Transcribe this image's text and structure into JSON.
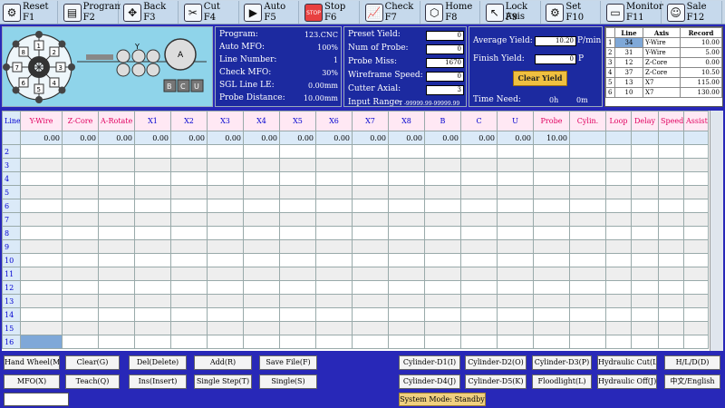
{
  "toolbar": [
    {
      "name": "Reset",
      "key": "F1",
      "icon": "gear-icon"
    },
    {
      "name": "Program",
      "key": "F2",
      "icon": "program-icon"
    },
    {
      "name": "Back",
      "key": "F3",
      "icon": "move-arrows-icon"
    },
    {
      "name": "Cut",
      "key": "F4",
      "icon": "scissors-icon"
    },
    {
      "name": "Auto",
      "key": "F5",
      "icon": "play-icon"
    },
    {
      "name": "Stop",
      "key": "F6",
      "icon": "stop-icon"
    },
    {
      "name": "Check",
      "key": "F7",
      "icon": "check-chart-icon"
    },
    {
      "name": "Home",
      "key": "F8",
      "icon": "home-icon"
    },
    {
      "name": "Lock Axis",
      "key": "F9",
      "icon": "cursor-icon"
    },
    {
      "name": "Set",
      "key": "F10",
      "icon": "settings-icon"
    },
    {
      "name": "Monitor",
      "key": "F11",
      "icon": "monitor-icon"
    },
    {
      "name": "Sale",
      "key": "F12",
      "icon": "user-icon"
    }
  ],
  "machine": {
    "y_label": "Y",
    "a_label": "A",
    "blocks": [
      "B",
      "C",
      "U"
    ],
    "wheel_numbers": [
      "1",
      "2",
      "3",
      "4",
      "5",
      "6",
      "7",
      "8"
    ]
  },
  "info1": {
    "rows": [
      {
        "label": "Program:",
        "value": "123.CNC"
      },
      {
        "label": "Auto MFO:",
        "value": "100%"
      },
      {
        "label": "Line Number:",
        "value": "1"
      },
      {
        "label": "Check MFO:",
        "value": "30%"
      },
      {
        "label": "SGL Line LE:",
        "value": "0.00mm"
      },
      {
        "label": "Probe Distance:",
        "value": "10.00mm"
      }
    ]
  },
  "info2": {
    "rows": [
      {
        "label": "Preset Yield:",
        "value": "0"
      },
      {
        "label": "Num of Probe:",
        "value": "0"
      },
      {
        "label": "Probe Miss:",
        "value": "1670"
      },
      {
        "label": "Wireframe Speed:",
        "value": "0"
      },
      {
        "label": "Cutter Axial:",
        "value": "3"
      }
    ],
    "input_range_label": "Input Range:",
    "input_range_value": "Y -99999.99-99999.99"
  },
  "yield": {
    "average_label": "Average Yield:",
    "average_value": "10.20",
    "average_unit": "P/min",
    "finish_label": "Finish Yield:",
    "finish_value": "0",
    "finish_unit": "P",
    "clear_label": "Clear Yield",
    "time_label": "Time Need:",
    "time_h": "0h",
    "time_m": "0m"
  },
  "records": {
    "headers": [
      "Line",
      "Axis",
      "Record"
    ],
    "rows": [
      {
        "idx": "1",
        "line": "34",
        "axis": "Y-Wire",
        "record": "10.00"
      },
      {
        "idx": "2",
        "line": "31",
        "axis": "Y-Wire",
        "record": "5.00"
      },
      {
        "idx": "3",
        "line": "12",
        "axis": "Z-Core",
        "record": "0.00"
      },
      {
        "idx": "4",
        "line": "37",
        "axis": "Z-Core",
        "record": "10.50"
      },
      {
        "idx": "5",
        "line": "13",
        "axis": "X7",
        "record": "115.00"
      },
      {
        "idx": "6",
        "line": "10",
        "axis": "X7",
        "record": "130.00"
      }
    ]
  },
  "grid": {
    "line_header": "Line",
    "columns": [
      "Y-Wire",
      "Z-Core",
      "A-Rotate",
      "X1",
      "X2",
      "X3",
      "X4",
      "X5",
      "X6",
      "X7",
      "X8",
      "B",
      "C",
      "U",
      "Probe",
      "Cylin.",
      "Loop",
      "Delay",
      "Speed",
      "Assist"
    ],
    "values": [
      "0.00",
      "0.00",
      "0.00",
      "0.00",
      "0.00",
      "0.00",
      "0.00",
      "0.00",
      "0.00",
      "0.00",
      "0.00",
      "0.00",
      "0.00",
      "0.00",
      "10.00",
      "",
      "",
      "",
      "",
      ""
    ],
    "line_numbers": [
      "2",
      "3",
      "4",
      "5",
      "6",
      "7",
      "8",
      "9",
      "10",
      "11",
      "12",
      "13",
      "14",
      "15",
      "16"
    ]
  },
  "bottom": {
    "row1": [
      "Hand Wheel(M)",
      "Clear(G)",
      "Del(Delete)",
      "Add(R)",
      "Save File(F)",
      "Cylinder-D1(I)",
      "Cylinder-D2(O)",
      "Cylinder-D3(P)",
      "Hydraulic Cut(L)",
      "H/L/D(D)"
    ],
    "row2": [
      "MFO(X)",
      "Teach(Q)",
      "Ins(Insert)",
      "Single Step(T)",
      "Single(S)",
      "Cylinder-D4(J)",
      "Cylinder-D5(K)",
      "Floodlight(L)",
      "Hydraulic Off(J)",
      "中文/English"
    ],
    "status": "System Mode: Standby"
  }
}
